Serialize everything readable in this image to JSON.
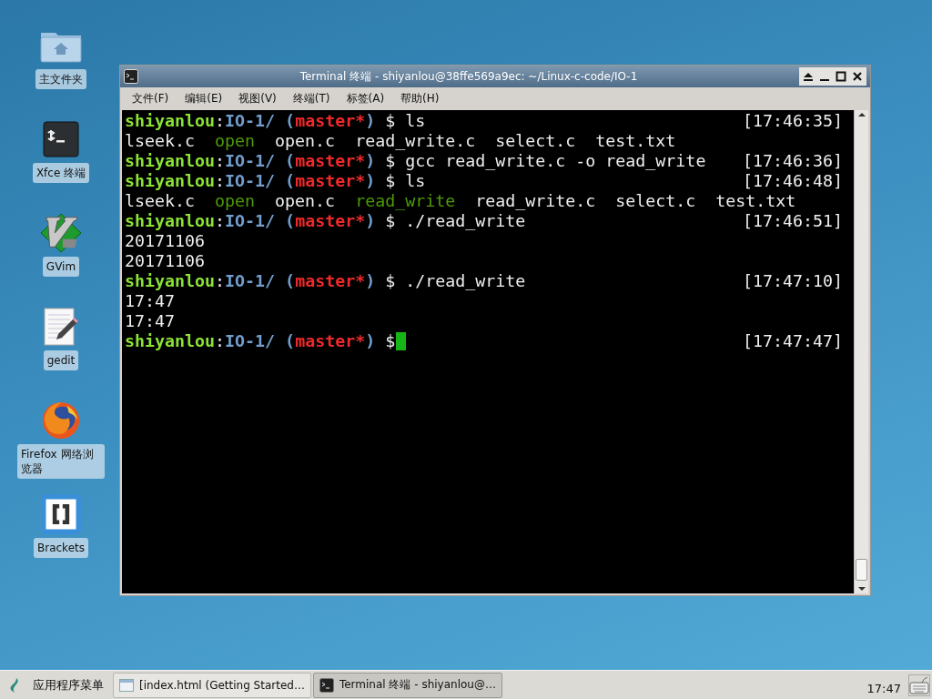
{
  "desktop_icons": [
    {
      "label": "主文件夹",
      "kind": "folder"
    },
    {
      "label": "Xfce 终端",
      "kind": "terminal"
    },
    {
      "label": "GVim",
      "kind": "vim"
    },
    {
      "label": "gedit",
      "kind": "editor"
    },
    {
      "label": "Firefox 网络浏览器",
      "kind": "browser"
    },
    {
      "label": "Brackets",
      "kind": "brackets"
    }
  ],
  "window": {
    "title": "Terminal 终端 - shiyanlou@38ffe569a9ec: ~/Linux-c-code/IO-1",
    "menu": [
      "文件(F)",
      "编辑(E)",
      "视图(V)",
      "终端(T)",
      "标签(A)",
      "帮助(H)"
    ]
  },
  "terminal_lines": [
    {
      "kind": "prompt",
      "segments": [
        {
          "text": "shiyanlou",
          "kind": "user"
        },
        {
          "text": ":",
          "kind": "plain"
        },
        {
          "text": "IO-1/ (",
          "kind": "path"
        },
        {
          "text": "master*",
          "kind": "branch"
        },
        {
          "text": ")",
          "kind": "path"
        },
        {
          "text": "$ ls",
          "kind": "plain"
        }
      ],
      "time": "[17:46:35]",
      "cursor": false
    },
    {
      "kind": "output",
      "items": [
        {
          "text": "lseek.c",
          "executable": false
        },
        {
          "text": "open",
          "executable": true
        },
        {
          "text": "open.c",
          "executable": false
        },
        {
          "text": "read_write.c",
          "executable": false
        },
        {
          "text": "select.c",
          "executable": false
        },
        {
          "text": "test.txt",
          "executable": false
        }
      ]
    },
    {
      "kind": "prompt",
      "segments": [
        {
          "text": "shiyanlou",
          "kind": "user"
        },
        {
          "text": ":",
          "kind": "plain"
        },
        {
          "text": "IO-1/ (",
          "kind": "path"
        },
        {
          "text": "master*",
          "kind": "branch"
        },
        {
          "text": ")",
          "kind": "path"
        },
        {
          "text": "$ gcc read_write.c -o read_write",
          "kind": "plain"
        }
      ],
      "time": "[17:46:36]",
      "cursor": false
    },
    {
      "kind": "prompt",
      "segments": [
        {
          "text": "shiyanlou",
          "kind": "user"
        },
        {
          "text": ":",
          "kind": "plain"
        },
        {
          "text": "IO-1/ (",
          "kind": "path"
        },
        {
          "text": "master*",
          "kind": "branch"
        },
        {
          "text": ")",
          "kind": "path"
        },
        {
          "text": "$ ls",
          "kind": "plain"
        }
      ],
      "time": "[17:46:48]",
      "cursor": false
    },
    {
      "kind": "output",
      "items": [
        {
          "text": "lseek.c",
          "executable": false
        },
        {
          "text": "open",
          "executable": true
        },
        {
          "text": "open.c",
          "executable": false
        },
        {
          "text": "read_write",
          "executable": true
        },
        {
          "text": "read_write.c",
          "executable": false
        },
        {
          "text": "select.c",
          "executable": false
        },
        {
          "text": "test.txt",
          "executable": false
        }
      ]
    },
    {
      "kind": "prompt",
      "segments": [
        {
          "text": "shiyanlou",
          "kind": "user"
        },
        {
          "text": ":",
          "kind": "plain"
        },
        {
          "text": "IO-1/ (",
          "kind": "path"
        },
        {
          "text": "master*",
          "kind": "branch"
        },
        {
          "text": ")",
          "kind": "path"
        },
        {
          "text": "$ ./read_write",
          "kind": "plain"
        }
      ],
      "time": "[17:46:51]",
      "cursor": false
    },
    {
      "kind": "output",
      "items": [
        {
          "text": "20171106",
          "executable": false
        }
      ]
    },
    {
      "kind": "output",
      "items": [
        {
          "text": "20171106",
          "executable": false
        }
      ]
    },
    {
      "kind": "prompt",
      "segments": [
        {
          "text": "shiyanlou",
          "kind": "user"
        },
        {
          "text": ":",
          "kind": "plain"
        },
        {
          "text": "IO-1/ (",
          "kind": "path"
        },
        {
          "text": "master*",
          "kind": "branch"
        },
        {
          "text": ")",
          "kind": "path"
        },
        {
          "text": "$ ./read_write",
          "kind": "plain"
        }
      ],
      "time": "[17:47:10]",
      "cursor": false
    },
    {
      "kind": "output",
      "items": [
        {
          "text": "17:47",
          "executable": false
        }
      ]
    },
    {
      "kind": "output",
      "items": [
        {
          "text": "17:47",
          "executable": false
        }
      ]
    },
    {
      "kind": "prompt",
      "segments": [
        {
          "text": "shiyanlou",
          "kind": "user"
        },
        {
          "text": ":",
          "kind": "plain"
        },
        {
          "text": "IO-1/ (",
          "kind": "path"
        },
        {
          "text": "master*",
          "kind": "branch"
        },
        {
          "text": ")",
          "kind": "path"
        },
        {
          "text": "$",
          "kind": "plain"
        }
      ],
      "time": "[17:47:47]",
      "cursor": true
    }
  ],
  "taskbar": {
    "app_menu": "应用程序菜单",
    "tasks": [
      {
        "label": "[index.html (Getting Started…",
        "kind": "browser",
        "selected": false
      },
      {
        "label": "Terminal 终端 - shiyanlou@…",
        "kind": "terminal",
        "selected": true
      }
    ],
    "clock": "17:47"
  }
}
